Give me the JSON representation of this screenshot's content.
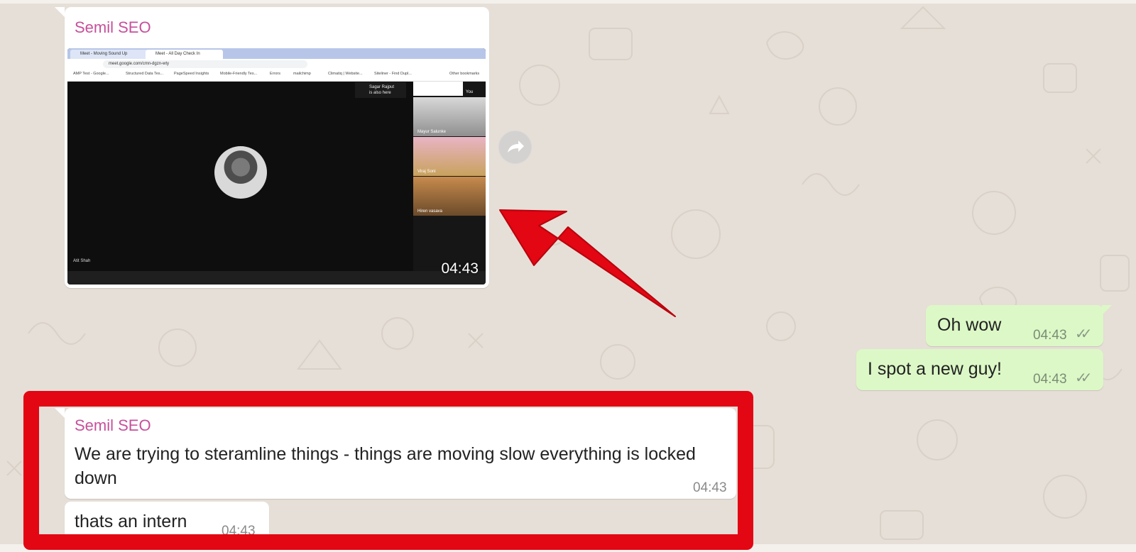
{
  "colors": {
    "sender_name": "#c6509b",
    "incoming_bubble": "#ffffff",
    "outgoing_bubble": "#dcf8c6",
    "highlight_red": "#e30613",
    "chat_background": "#e6dfd7"
  },
  "messages": [
    {
      "direction": "incoming",
      "sender": "Semil SEO",
      "type": "video",
      "duration": "04:43",
      "video_screen": {
        "tabs": [
          "Meet - Moving Sound Up",
          "Meet - All Day Check In"
        ],
        "url": "meet.google.com/cmn-dgzn-wty",
        "bookmarks": [
          "AMP Test - Google...",
          "Structured Data Tes...",
          "PageSpeed Insights",
          "Mobile-Friendly Tes...",
          "Errors",
          "mailchimp",
          "Climatiq | Website...",
          "Siteliner - Find Dupl...",
          "Other bookmarks"
        ],
        "notice_name": "Sagar Rajput",
        "notice_text": "is also here",
        "self_label": "You",
        "main_participant": "Atit Shah",
        "tiles": [
          "Mayur Salunke",
          "Viraj Soni",
          "Hiren vasava"
        ]
      },
      "forward_icon": "forward-arrow-icon"
    },
    {
      "direction": "outgoing",
      "text": "Oh wow",
      "time": "04:43",
      "status_icon": "double-check-icon"
    },
    {
      "direction": "outgoing",
      "text": "I spot a new guy!",
      "time": "04:43",
      "status_icon": "double-check-icon"
    },
    {
      "direction": "incoming",
      "sender": "Semil SEO",
      "text_line1": "We are trying to steramline things - things are moving slow everything is locked",
      "text_line2": "down",
      "time": "04:43"
    },
    {
      "direction": "incoming",
      "text": "thats an intern",
      "time": "04:43"
    }
  ],
  "annotations": {
    "arrow": "red-arrow",
    "frame": "red-highlight-frame"
  }
}
